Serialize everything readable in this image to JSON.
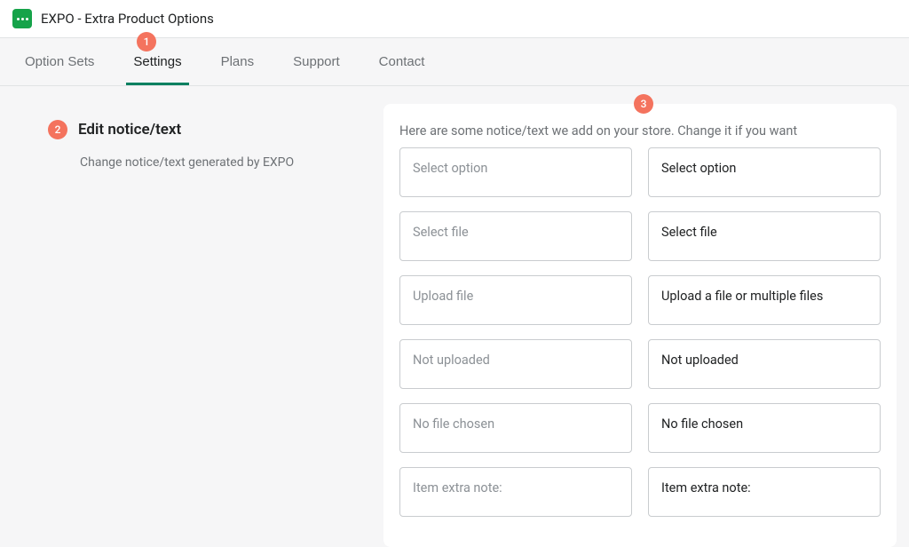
{
  "header": {
    "app_title": "EXPO - Extra Product Options"
  },
  "tabs": {
    "option_sets": "Option Sets",
    "settings": "Settings",
    "plans": "Plans",
    "support": "Support",
    "contact": "Contact"
  },
  "leftPanel": {
    "title": "Edit notice/text",
    "description": "Change notice/text generated by EXPO"
  },
  "rightPanel": {
    "intro": "Here are some notice/text we add on your store. Change it if you want",
    "rows": [
      {
        "placeholder": "Select option",
        "value": "Select option"
      },
      {
        "placeholder": "Select file",
        "value": "Select file"
      },
      {
        "placeholder": "Upload file",
        "value": "Upload a file or multiple files"
      },
      {
        "placeholder": "Not uploaded",
        "value": "Not uploaded"
      },
      {
        "placeholder": "No file chosen",
        "value": "No file chosen"
      },
      {
        "placeholder": "Item extra note:",
        "value": "Item extra note:"
      }
    ]
  },
  "annotations": {
    "a1": "1",
    "a2": "2",
    "a3": "3"
  }
}
